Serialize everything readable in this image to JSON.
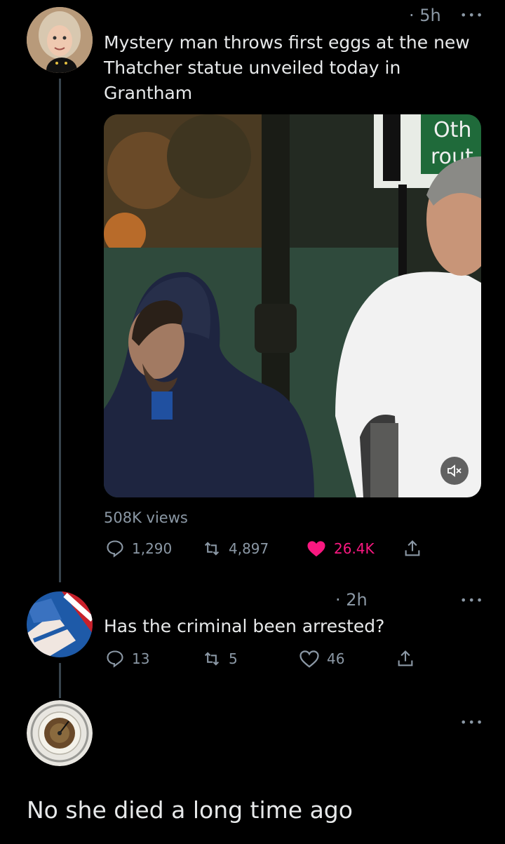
{
  "tweet1": {
    "time": "· 5h",
    "text": "Mystery man throws first eggs at the new Thatcher statue unveiled today in Grantham",
    "media_sign_text_line1": "Oth",
    "media_sign_text_line2": "rout",
    "views": "508K views",
    "replies": "1,290",
    "retweets": "4,897",
    "likes": "26.4K",
    "like_color": "#f91880"
  },
  "tweet2": {
    "time": "· 2h",
    "text": "Has the criminal been arrested?",
    "replies": "13",
    "retweets": "5",
    "likes": "46"
  },
  "tweet3": {
    "text": "No she died a long time ago"
  },
  "icons": {
    "reply": "reply-icon",
    "retweet": "retweet-icon",
    "like": "heart-icon",
    "share": "share-icon",
    "more": "more-icon",
    "mute": "mute-icon"
  },
  "colors": {
    "background": "#000000",
    "text": "#e7e9ea",
    "secondary": "#8b98a5",
    "thread_line": "#38444d"
  }
}
